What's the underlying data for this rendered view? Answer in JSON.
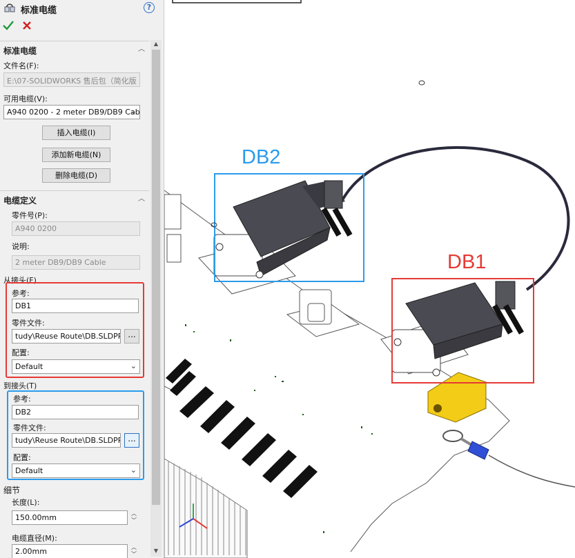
{
  "panel": {
    "title": "标准电缆",
    "help": "?",
    "sections": {
      "cable": {
        "title": "标准电缆",
        "file_label": "文件名(F):",
        "file_value": "E:\\07-SOLIDWORKS 售后包（简化版",
        "available_label": "可用电缆(V):",
        "available_value": "A940 0200 - 2 meter DB9/DB9 Cabl",
        "insert_button": "插入电缆(I)",
        "add_button": "添加新电缆(N)",
        "delete_button": "删除电缆(D)"
      },
      "definition": {
        "title": "电缆定义",
        "part_label": "零件号(P):",
        "part_value": "A940 0200",
        "desc_label": "说明:",
        "desc_value": "2 meter DB9/DB9 Cable"
      },
      "from": {
        "title": "从接头(F)",
        "ref_label": "参考:",
        "ref_value": "DB1",
        "partfile_label": "零件文件:",
        "partfile_value": "tudy\\Reuse Route\\DB.SLDPRT",
        "config_label": "配置:",
        "config_value": "Default",
        "browse": "..."
      },
      "to": {
        "title": "到接头(T)",
        "ref_label": "参考:",
        "ref_value": "DB2",
        "partfile_label": "零件文件:",
        "partfile_value": "tudy\\Reuse Route\\DB.SLDPRT",
        "config_label": "配置:",
        "config_value": "Default",
        "browse": "..."
      },
      "details": {
        "title": "细节",
        "length_label": "长度(L):",
        "length_value": "150.00mm",
        "diameter_label": "电缆直径(M):",
        "diameter_value": "2.00mm"
      }
    }
  },
  "viewport": {
    "labels": {
      "db2": "DB2",
      "db1": "DB1"
    }
  },
  "colors": {
    "red": "#e53935",
    "blue": "#2a9bec",
    "ok": "#1f9a3a",
    "cancel": "#d42020",
    "connector": "#4a4a52",
    "terminal": "#f2cc17",
    "lug_sleeve": "#2f4fd6"
  },
  "icons": [
    "cable-icon",
    "help-icon",
    "ok-check-icon",
    "cancel-x-icon",
    "collapse-chevron-icon",
    "dropdown-arrow-icon",
    "spinner-icon",
    "triad-icon"
  ]
}
